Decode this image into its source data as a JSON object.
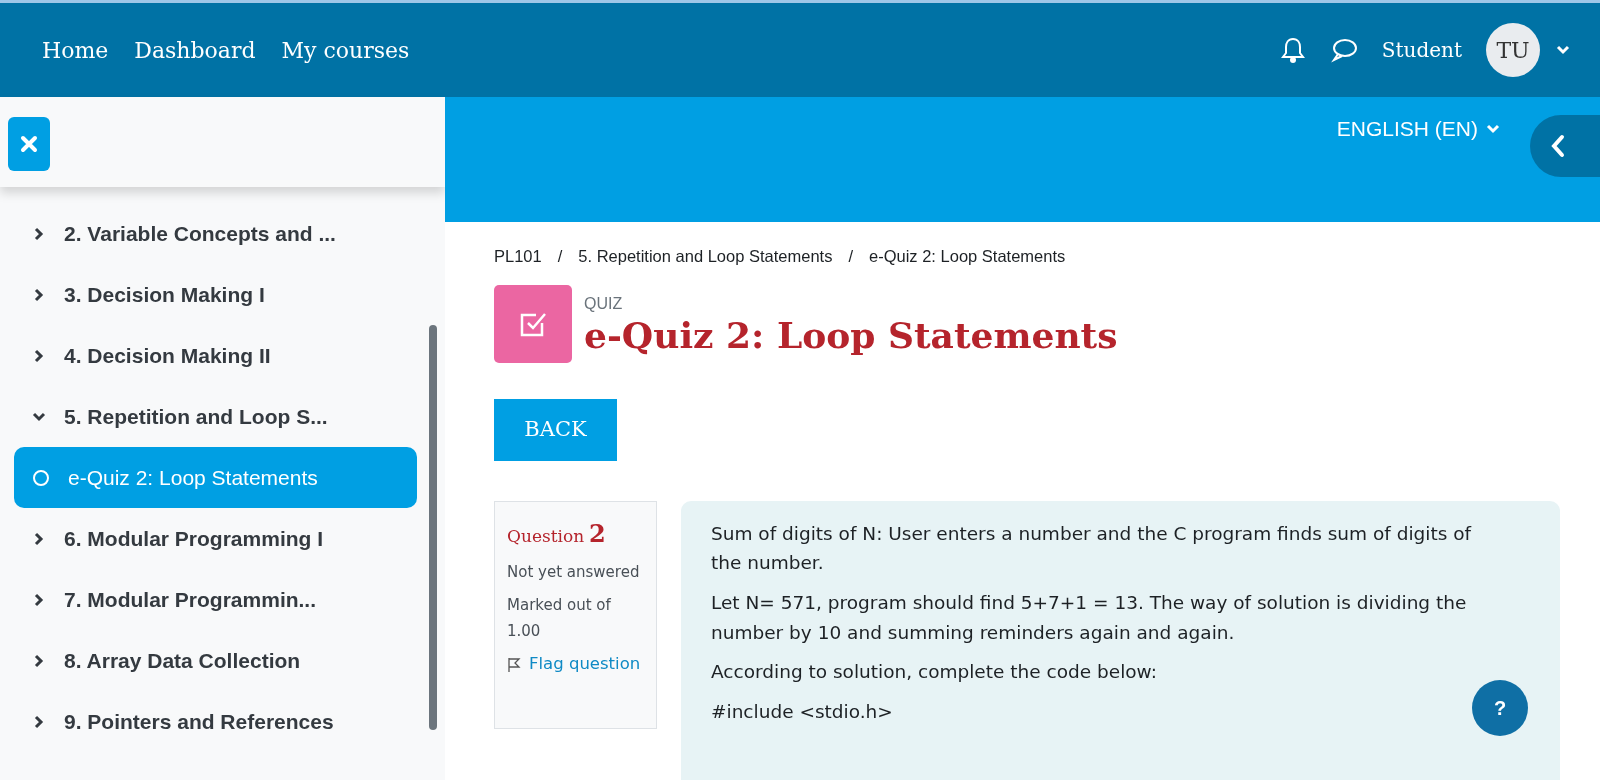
{
  "navbar": {
    "links": [
      "Home",
      "Dashboard",
      "My courses"
    ],
    "user_name": "Student",
    "avatar_initials": "TU"
  },
  "drawer": {
    "items": [
      {
        "kind": "section",
        "label": "2. Variable Concepts and ...",
        "expanded": false,
        "selected": false
      },
      {
        "kind": "section",
        "label": "3. Decision Making I",
        "expanded": false,
        "selected": false
      },
      {
        "kind": "section",
        "label": "4. Decision Making II",
        "expanded": false,
        "selected": false
      },
      {
        "kind": "section",
        "label": "5. Repetition and Loop S...",
        "expanded": true,
        "selected": false
      },
      {
        "kind": "activity",
        "label": "e-Quiz 2: Loop Statements",
        "selected": true
      },
      {
        "kind": "section",
        "label": "6. Modular Programming I",
        "expanded": false,
        "selected": false
      },
      {
        "kind": "section",
        "label": "7. Modular Programmin...",
        "expanded": false,
        "selected": false
      },
      {
        "kind": "section",
        "label": "8. Array Data Collection",
        "expanded": false,
        "selected": false
      },
      {
        "kind": "section",
        "label": "9. Pointers and References",
        "expanded": false,
        "selected": false
      }
    ]
  },
  "header": {
    "language": "ENGLISH (EN)"
  },
  "breadcrumb": [
    {
      "label": "PL101"
    },
    {
      "separator": "/",
      "label": "5. Repetition and Loop Statements"
    },
    {
      "separator": "/",
      "label": "e-Quiz 2: Loop Statements"
    }
  ],
  "activity": {
    "type_label": "QUIZ",
    "title": "e-Quiz 2: Loop Statements",
    "back_button": "BACK"
  },
  "question": {
    "label": "Question",
    "number": "2",
    "state": "Not yet answered",
    "grade": "Marked out of 1.00",
    "flag_label": "Flag question",
    "paragraphs": [
      "Sum of digits of N: User enters a number and the C program finds sum of digits of the number.",
      "Let N= 571, program should find 5+7+1 = 13. The way of solution is dividing the number by 10 and summing reminders again and again.",
      "According to solution, complete the code below:",
      "#include <stdio.h>"
    ]
  },
  "help_button": "?"
}
